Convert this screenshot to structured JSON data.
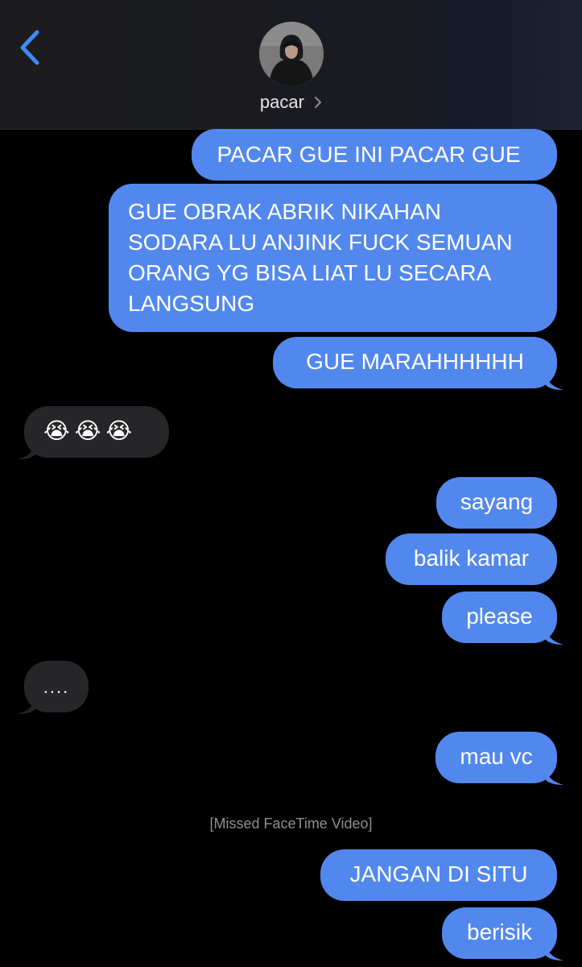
{
  "header": {
    "contact_name": "pacar",
    "back_icon": "chevron-left-icon",
    "contact_chevron_icon": "chevron-right-icon"
  },
  "colors": {
    "outgoing_bubble": "#5288ee",
    "incoming_bubble": "#262628",
    "accent": "#3d8bf7"
  },
  "messages": [
    {
      "side": "out",
      "text": "PACAR GUE INI PACAR GUE"
    },
    {
      "side": "out",
      "text": "GUE OBRAK ABRIK NIKAHAN SODARA LU ANJINK FUCK SEMUAN ORANG YG BISA LIAT LU SECARA LANGSUNG"
    },
    {
      "side": "out",
      "text": "GUE MARAHHHHHH"
    },
    {
      "side": "in",
      "text": "😭😭😭",
      "emoji_name": "loudly-crying-face-emoji"
    },
    {
      "side": "out",
      "text": "sayang"
    },
    {
      "side": "out",
      "text": "balik kamar"
    },
    {
      "side": "out",
      "text": "please"
    },
    {
      "side": "in",
      "text": "...."
    },
    {
      "side": "out",
      "text": "mau vc"
    },
    {
      "side": "system",
      "text": "[Missed FaceTime Video]"
    },
    {
      "side": "out",
      "text": "JANGAN DI SITU"
    },
    {
      "side": "out",
      "text": "berisik"
    }
  ]
}
